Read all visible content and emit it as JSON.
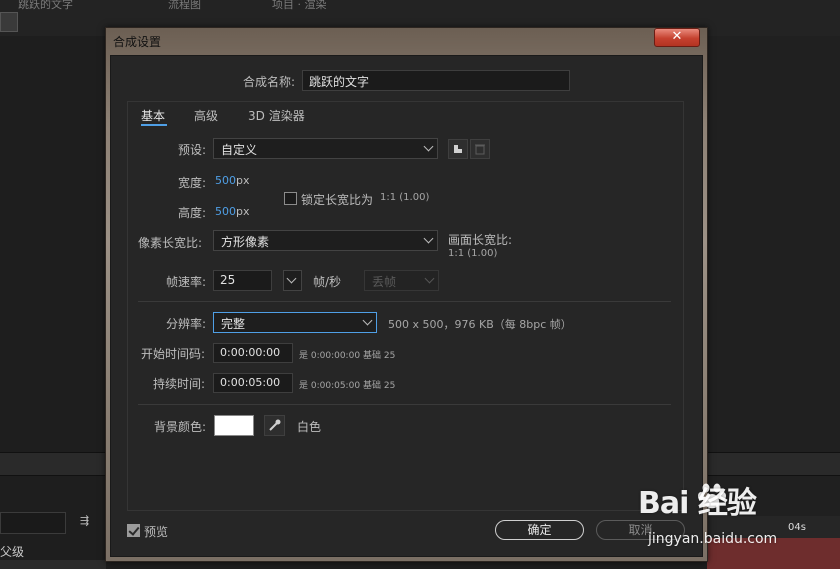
{
  "background": {
    "top_tabs": [
      "跳跃的文字",
      "流程图",
      "项目 · 渲染"
    ],
    "parent_label": "父级",
    "timeline_tick": "04s"
  },
  "dialog": {
    "title": "合成设置",
    "close": "✕",
    "comp_name_label": "合成名称:",
    "comp_name_value": "跳跃的文字",
    "tabs": [
      "基本",
      "高级",
      "3D 渲染器"
    ],
    "preset_label": "预设:",
    "preset_value": "自定义",
    "width_label": "宽度:",
    "width_value": "500",
    "width_unit": "px",
    "height_label": "高度:",
    "height_value": "500",
    "height_unit": "px",
    "lock_aspect_label": "锁定长宽比为",
    "lock_aspect_value": "1:1 (1.00)",
    "pixel_aspect_label": "像素长宽比:",
    "pixel_aspect_value": "方形像素",
    "frame_aspect_label": "画面长宽比:",
    "frame_aspect_value": "1:1 (1.00)",
    "frame_rate_label": "帧速率:",
    "frame_rate_value": "25",
    "frame_rate_unit": "帧/秒",
    "drop_frame_value": "丢帧",
    "resolution_label": "分辨率:",
    "resolution_value": "完整",
    "resolution_info": "500 x 500，976 KB（每 8bpc 帧）",
    "start_timecode_label": "开始时间码:",
    "start_timecode_value": "0:00:00:00",
    "start_timecode_info": "是 0:00:00:00",
    "start_timecode_base": "基础 25",
    "duration_label": "持续时间:",
    "duration_value": "0:00:05:00",
    "duration_info": "是 0:00:05:00",
    "duration_base": "基础 25",
    "bg_color_label": "背景颜色:",
    "bg_color_value": "#ffffff",
    "bg_color_name": "白色",
    "preview_label": "预览",
    "ok_label": "确定",
    "cancel_label": "取消"
  },
  "watermark": {
    "brand": "Bai 经验",
    "url": "jingyan.baidu.com"
  },
  "colors": {
    "accent": "#4f9fe6",
    "close": "#c5412f"
  }
}
